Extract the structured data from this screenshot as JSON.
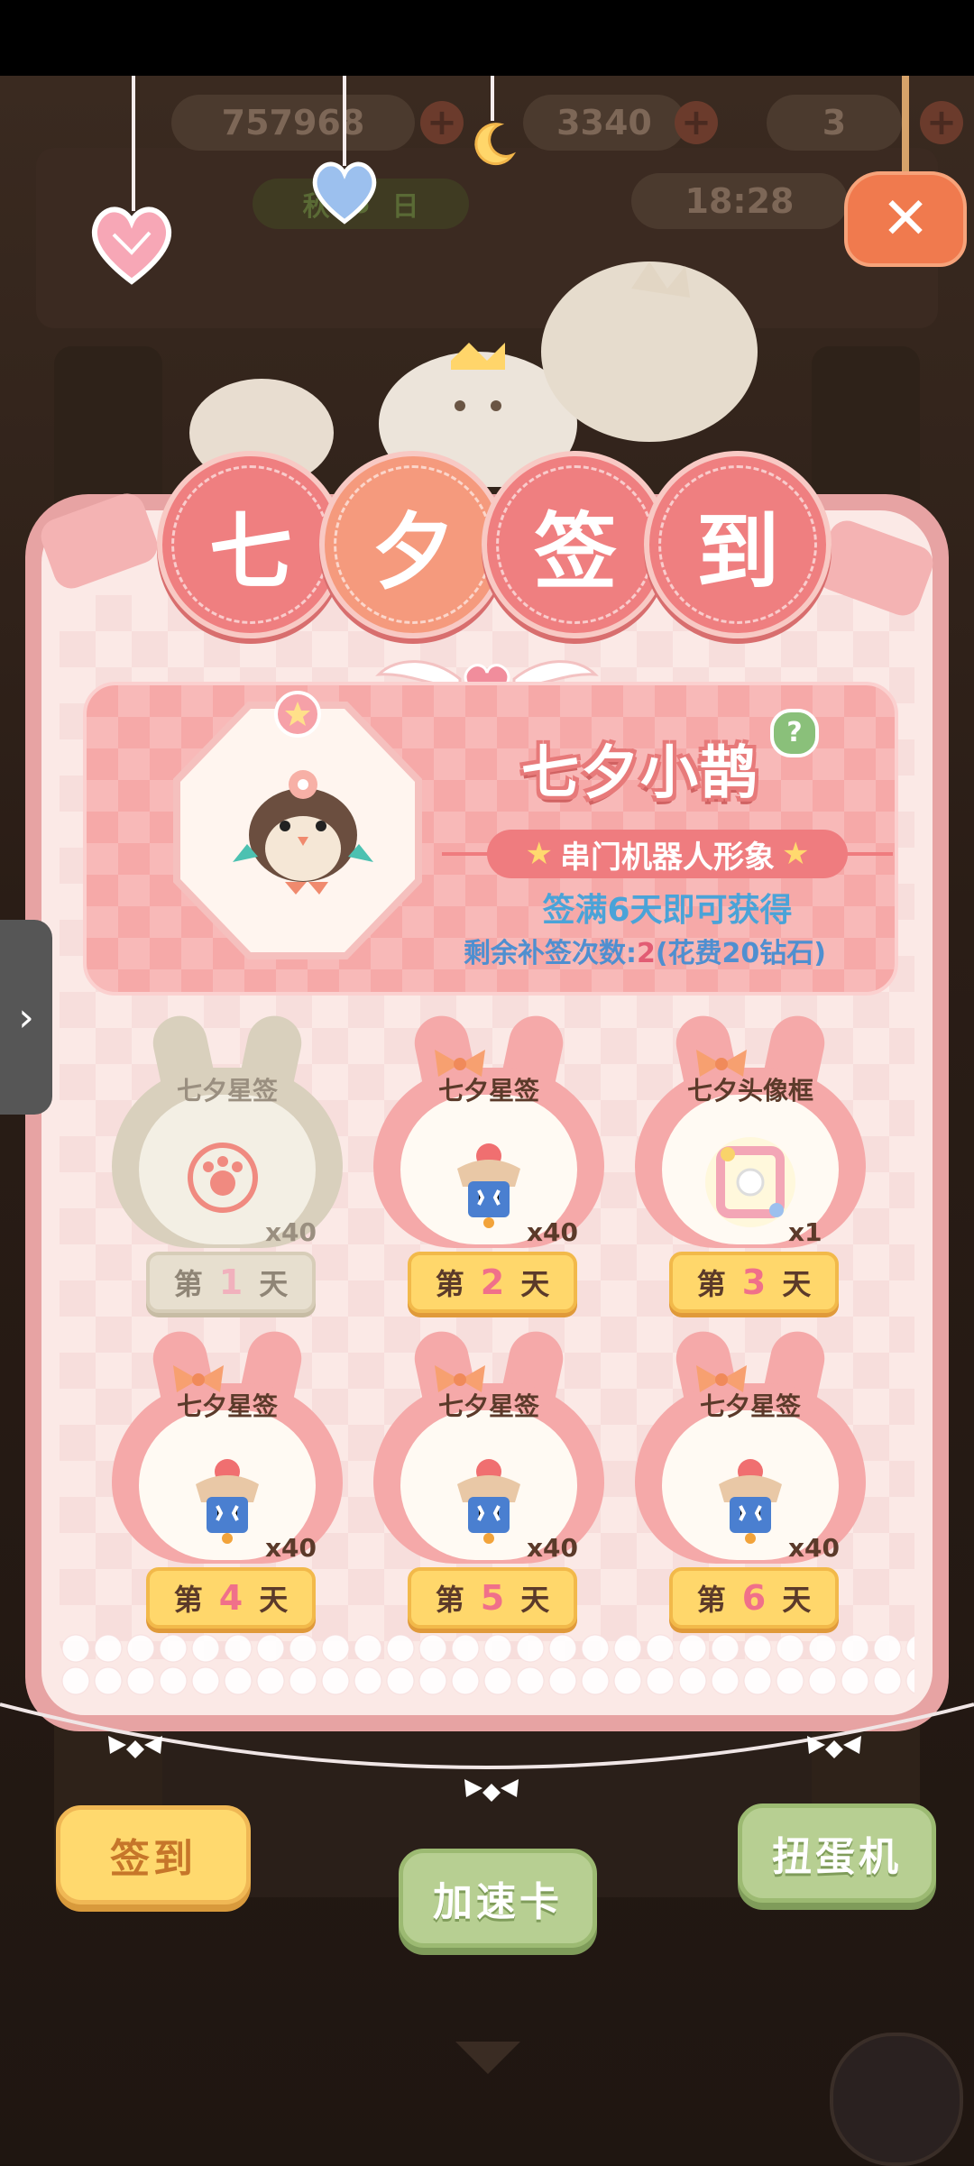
{
  "background": {
    "resources": [
      "757968",
      "3340",
      "3"
    ],
    "time": "18:28",
    "dim_labels": [
      "秋",
      "5",
      "日"
    ]
  },
  "title": [
    "七",
    "夕",
    "签",
    "到"
  ],
  "banner": {
    "pet_name": "七夕小鹊",
    "help": "?",
    "ribbon": "串门机器人形象",
    "condition": "签满6天即可获得",
    "retro_label": "剩余补签次数:",
    "retro_count": "2",
    "retro_cost": "(花费20钻石)"
  },
  "days": [
    {
      "label": "七夕星签",
      "qty": "x40",
      "pre": "第",
      "num": "1",
      "post": "天",
      "state": "claimed",
      "icon": "paw-stamp-icon"
    },
    {
      "label": "七夕星签",
      "qty": "x40",
      "pre": "第",
      "num": "2",
      "post": "天",
      "state": "available",
      "icon": "star-charm-icon"
    },
    {
      "label": "七夕头像框",
      "qty": "x1",
      "pre": "第",
      "num": "3",
      "post": "天",
      "state": "available",
      "icon": "avatar-frame-icon"
    },
    {
      "label": "七夕星签",
      "qty": "x40",
      "pre": "第",
      "num": "4",
      "post": "天",
      "state": "available",
      "icon": "star-charm-icon"
    },
    {
      "label": "七夕星签",
      "qty": "x40",
      "pre": "第",
      "num": "5",
      "post": "天",
      "state": "available",
      "icon": "star-charm-icon"
    },
    {
      "label": "七夕星签",
      "qty": "x40",
      "pre": "第",
      "num": "6",
      "post": "天",
      "state": "available",
      "icon": "star-charm-icon"
    }
  ],
  "bottom_buttons": {
    "checkin": "签到",
    "speedup": "加速卡",
    "gacha": "扭蛋机"
  },
  "side_tab": "›",
  "colors": {
    "accent_pink": "#ef7f80",
    "day_button": "#ffd76b",
    "green_button": "#b7cf92"
  }
}
